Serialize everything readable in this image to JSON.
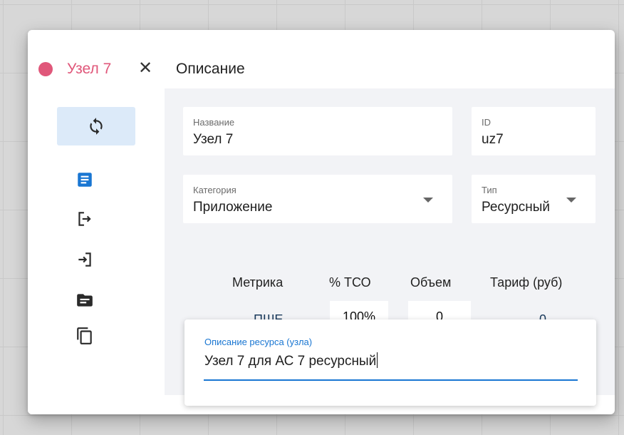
{
  "header": {
    "node_name": "Узел 7",
    "node_color": "#e0577a",
    "close_glyph": "✕",
    "tab_title": "Описание"
  },
  "sidebar": {
    "items": [
      {
        "icon": "sync-icon",
        "active": true
      },
      {
        "icon": "description-icon",
        "color": "#1976d2"
      },
      {
        "icon": "logout-icon"
      },
      {
        "icon": "login-icon"
      },
      {
        "icon": "folder-icon"
      },
      {
        "icon": "copy-icon"
      }
    ]
  },
  "form": {
    "name": {
      "label": "Название",
      "value": "Узел 7"
    },
    "id": {
      "label": "ID",
      "value": "uz7"
    },
    "category": {
      "label": "Категория",
      "value": "Приложение"
    },
    "type": {
      "label": "Тип",
      "value": "Ресурсный"
    }
  },
  "metrics": {
    "headers": [
      "Метрика",
      "% ТСО",
      "Объем",
      "Тариф (руб)"
    ],
    "row": {
      "metric": "ПШЕ",
      "tco": "100%",
      "volume": "0",
      "tariff": "0"
    }
  },
  "description": {
    "label": "Описание ресурса (узла)",
    "value": "Узел 7 для АС 7 ресурсный",
    "accent": "#1976d2"
  }
}
